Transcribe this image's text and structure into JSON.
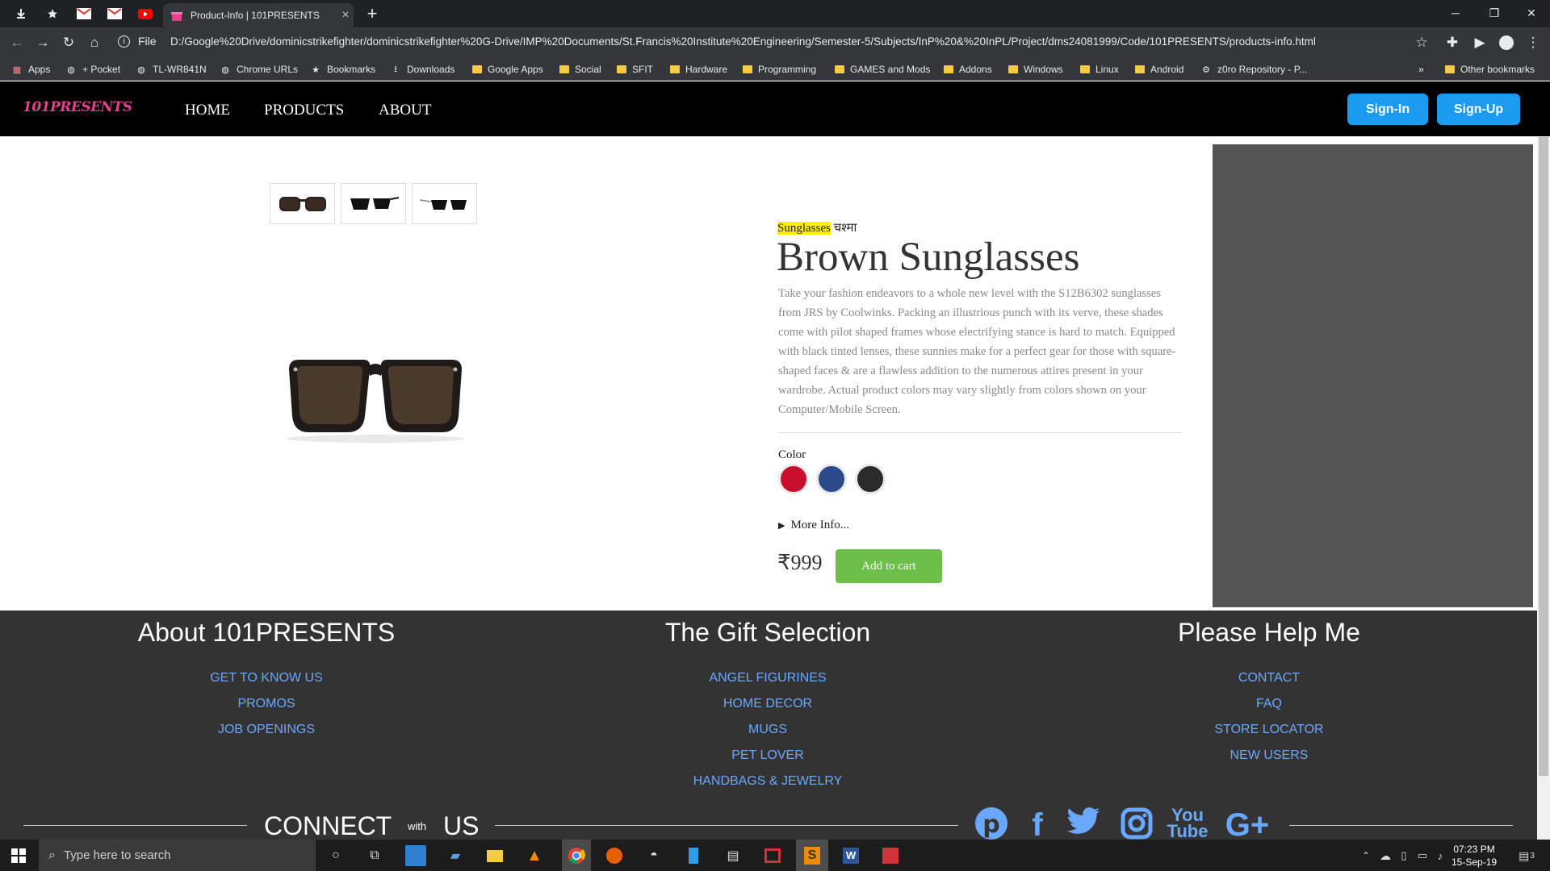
{
  "browser": {
    "tab_title": "Product-Info | 101PRESENTS",
    "tab_close": "×",
    "new_tab": "+",
    "url_prefix": "File",
    "url": "D:/Google%20Drive/dominicstrikefighter/dominicstrikefighter%20G-Drive/IMP%20Documents/St.Francis%20Institute%20Engineering/Semester-5/Subjects/InP%20&%20InPL/Project/dms24081999/Code/101PRESENTS/products-info.html",
    "bookmarks": [
      {
        "label": "Apps",
        "icon": "apps-grid-icon"
      },
      {
        "label": "+ Pocket",
        "icon": "globe-icon"
      },
      {
        "label": "TL-WR841N",
        "icon": "globe-icon"
      },
      {
        "label": "Chrome URLs",
        "icon": "globe-icon"
      },
      {
        "label": "Bookmarks",
        "icon": "star-icon"
      },
      {
        "label": "Downloads",
        "icon": "download-icon"
      },
      {
        "label": "Google Apps",
        "icon": "folder-icon"
      },
      {
        "label": "Social",
        "icon": "folder-icon"
      },
      {
        "label": "SFIT",
        "icon": "folder-icon"
      },
      {
        "label": "Hardware",
        "icon": "folder-icon"
      },
      {
        "label": "Programming",
        "icon": "folder-icon"
      },
      {
        "label": "GAMES and Mods",
        "icon": "folder-icon"
      },
      {
        "label": "Addons",
        "icon": "folder-icon"
      },
      {
        "label": "Windows",
        "icon": "folder-icon"
      },
      {
        "label": "Linux",
        "icon": "folder-icon"
      },
      {
        "label": "Android",
        "icon": "folder-icon"
      },
      {
        "label": "z0ro Repository - P...",
        "icon": "gear-icon"
      }
    ],
    "bookmarks_overflow": "»",
    "other_bookmarks": "Other bookmarks"
  },
  "site": {
    "logo": "101PRESENTS",
    "nav": {
      "home": "HOME",
      "products": "PRODUCTS",
      "about": "ABOUT"
    },
    "signin": "Sign-In",
    "signup": "Sign-Up"
  },
  "product": {
    "category": "Sunglasses",
    "category_hindi": "चश्मा",
    "title": "Brown Sunglasses",
    "description": "Take your fashion endeavors to a whole new level with the S12B6302 sunglasses from JRS by Coolwinks. Packing an illustrious punch with its verve, these shades come with pilot shaped frames whose electrifying stance is hard to match. Equipped with black tinted lenses, these sunnies make for a perfect gear for those with square-shaped faces & are a flawless addition to the numerous attires present in your wardrobe. Actual product colors may vary slightly from colors shown on your Computer/Mobile Screen.",
    "color_label": "Color",
    "colors": [
      "#c8102e",
      "#2a4a8c",
      "#2b2b2b"
    ],
    "more_info": "More Info...",
    "price": "₹999",
    "add_to_cart": "Add to cart"
  },
  "footer": {
    "about": {
      "title": "About 101PRESENTS",
      "links": [
        "GET TO KNOW US",
        "PROMOS",
        "JOB OPENINGS"
      ]
    },
    "gifts": {
      "title": "The Gift Selection",
      "links": [
        "ANGEL FIGURINES",
        "HOME DECOR",
        "MUGS",
        "PET LOVER",
        "HANDBAGS & JEWELRY"
      ]
    },
    "help": {
      "title": "Please Help Me",
      "links": [
        "CONTACT",
        "FAQ",
        "STORE LOCATOR",
        "NEW USERS"
      ]
    },
    "connect": {
      "word1": "CONNECT",
      "word2": "with",
      "word3": "US"
    },
    "social": [
      "pinterest-icon",
      "facebook-icon",
      "twitter-icon",
      "instagram-icon",
      "youtube-icon",
      "google-plus-icon"
    ]
  },
  "taskbar": {
    "search_placeholder": "Type here to search",
    "time": "07:23 PM",
    "date": "15-Sep-19",
    "notifications": "3"
  }
}
